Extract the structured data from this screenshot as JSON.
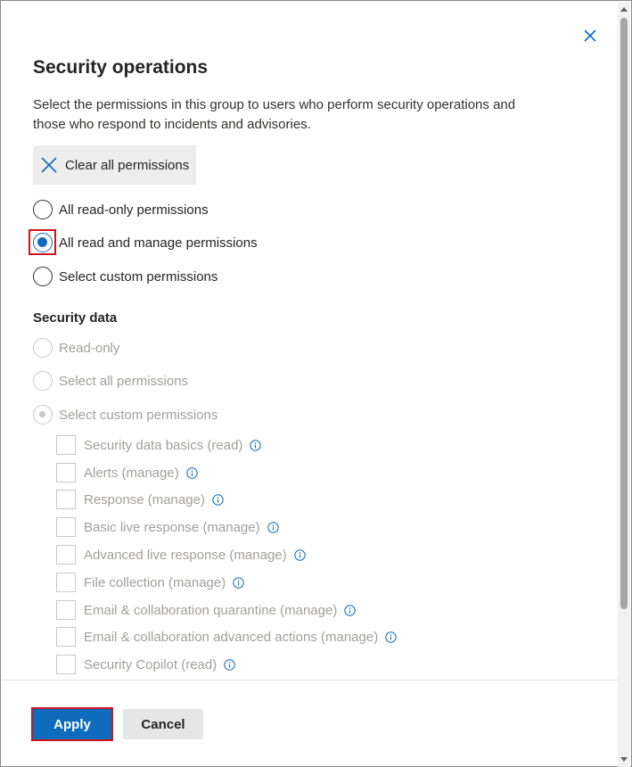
{
  "panel": {
    "title": "Security operations",
    "description": "Select the permissions in this group to users who perform security operations and those who respond to incidents and advisories.",
    "close_icon": "close-icon"
  },
  "clear_button": {
    "label": "Clear all permissions",
    "icon": "close-icon"
  },
  "group_options": [
    {
      "label": "All read-only permissions",
      "checked": false
    },
    {
      "label": "All read and manage permissions",
      "checked": true
    },
    {
      "label": "Select custom permissions",
      "checked": false
    }
  ],
  "security_data": {
    "heading": "Security data",
    "options": [
      {
        "label": "Read-only",
        "disabled": true
      },
      {
        "label": "Select all permissions",
        "disabled": true
      },
      {
        "label": "Select custom permissions",
        "disabled": true,
        "selected": true
      }
    ],
    "permissions": [
      {
        "label": "Security data basics (read)",
        "info_icon": "info-icon"
      },
      {
        "label": "Alerts (manage)",
        "info_icon": "info-icon"
      },
      {
        "label": "Response (manage)",
        "info_icon": "info-icon"
      },
      {
        "label": "Basic live response (manage)",
        "info_icon": "info-icon"
      },
      {
        "label": "Advanced live response (manage)",
        "info_icon": "info-icon"
      },
      {
        "label": "File collection (manage)",
        "info_icon": "info-icon"
      },
      {
        "label": "Email & collaboration quarantine (manage)",
        "info_icon": "info-icon"
      },
      {
        "label": "Email & collaboration advanced actions (manage)",
        "info_icon": "info-icon"
      },
      {
        "label": "Security Copilot (read)",
        "info_icon": "info-icon"
      }
    ]
  },
  "footer": {
    "apply_label": "Apply",
    "cancel_label": "Cancel"
  },
  "colors": {
    "accent": "#0f6cbd",
    "highlight": "#d1131c",
    "disabled": "#c8c8c8"
  }
}
